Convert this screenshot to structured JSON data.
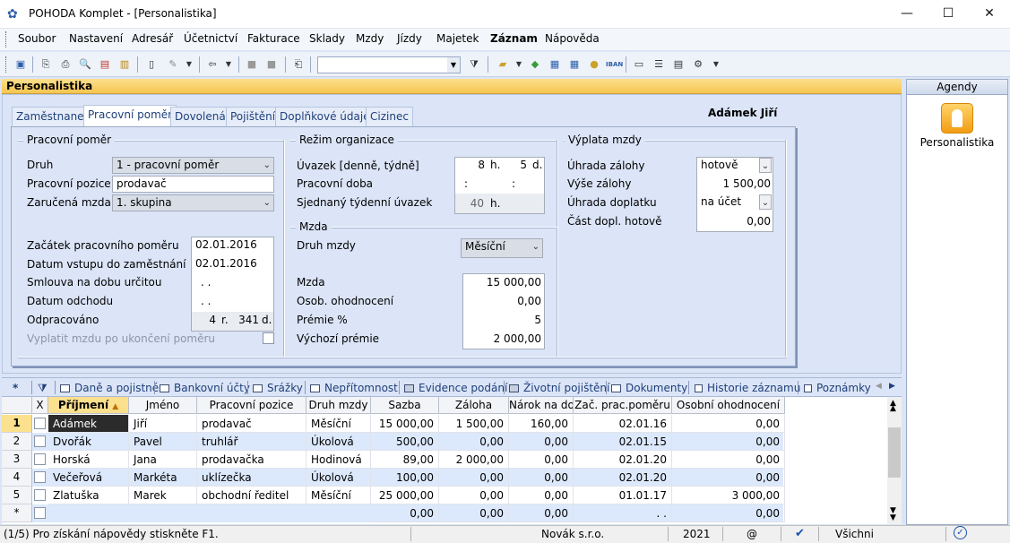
{
  "window": {
    "title": "POHODA Komplet - [Personalistika]",
    "minimize": "—",
    "maximize": "☐",
    "close": "✕"
  },
  "menu": [
    "Soubor",
    "Nastavení",
    "Adresář",
    "Účetnictví",
    "Fakturace",
    "Sklady",
    "Mzdy",
    "Jízdy",
    "Majetek",
    "Záznam",
    "Nápověda"
  ],
  "agenda": {
    "title": "Personalistika"
  },
  "agendy_panel": {
    "header": "Agendy",
    "item": "Personalistika"
  },
  "tabs": [
    "Zaměstnanec",
    "Pracovní poměr",
    "Dovolená",
    "Pojištění",
    "Doplňkové údaje",
    "Cizinec"
  ],
  "active_tab": "Pracovní poměr",
  "employee_name": "Adámek Jiří",
  "pracovni_pomer": {
    "title": "Pracovní poměr",
    "druh_label": "Druh",
    "druh_value": "1 - pracovní poměr",
    "pozice_label": "Pracovní pozice",
    "pozice_value": "prodavač",
    "mzda_label": "Zaručená mzda",
    "mzda_value": "1. skupina",
    "zacatek_label": "Začátek pracovního poměru",
    "zacatek_value": "02.01.2016",
    "vstup_label": "Datum vstupu do zaměstnání",
    "vstup_value": "02.01.2016",
    "urcita_label": "Smlouva na dobu určitou",
    "urcita_value": ". .",
    "odchod_label": "Datum odchodu",
    "odchod_value": ". .",
    "odpracovano_label": "Odpracováno",
    "odpracovano_r": "4",
    "odpracovano_r_unit": "r.",
    "odpracovano_d": "341",
    "odpracovano_d_unit": "d.",
    "vyplatit_label": "Vyplatit mzdu po ukončení poměru"
  },
  "rezim": {
    "title": "Režim organizace",
    "uvazek_label": "Úvazek  [denně, týdně]",
    "uvazek_h": "8",
    "uvazek_h_unit": "h.",
    "uvazek_d": "5",
    "uvazek_d_unit": "d.",
    "doba_label": "Pracovní doba",
    "doba_1": ":",
    "doba_2": ":",
    "sjednany_label": "Sjednaný týdenní úvazek",
    "sjednany_value": "40",
    "sjednany_unit": "h."
  },
  "mzda": {
    "title": "Mzda",
    "druh_label": "Druh mzdy",
    "druh_value": "Měsíční",
    "mzda_label": "Mzda",
    "mzda_value": "15 000,00",
    "osob_label": "Osob. ohodnocení",
    "osob_value": "0,00",
    "premie_label": "Prémie %",
    "premie_value": "5",
    "vychozi_label": "Výchozí prémie",
    "vychozi_value": "2 000,00"
  },
  "vyplata": {
    "title": "Výplata mzdy",
    "uhrada_zal_label": "Úhrada zálohy",
    "uhrada_zal_value": "hotově",
    "vyse_label": "Výše zálohy",
    "vyse_value": "1 500,00",
    "uhrada_dopl_label": "Úhrada doplatku",
    "uhrada_dopl_value": "na účet",
    "cast_label": "Část dopl. hotově",
    "cast_value": "0,00"
  },
  "bottom_tabs": {
    "star": "*",
    "items": [
      "Daně a pojistné",
      "Bankovní účty",
      "Srážky",
      "Nepřítomnost",
      "Evidence podání",
      "Životní pojištění",
      "Dokumenty",
      "Historie záznamu",
      "Poznámky"
    ]
  },
  "grid": {
    "columns": [
      "X",
      "Příjmení",
      "Jméno",
      "Pracovní pozice",
      "Druh mzdy",
      "Sazba",
      "Záloha",
      "Nárok na dov",
      "Zač. prac.poměru",
      "Osobní ohodnocení"
    ],
    "rows": [
      {
        "n": "1",
        "prijmeni": "Adámek",
        "jmeno": "Jiří",
        "pozice": "prodavač",
        "druh": "Měsíční",
        "sazba": "15 000,00",
        "zaloha": "1 500,00",
        "narok": "160,00",
        "zac": "02.01.16",
        "osob": "0,00"
      },
      {
        "n": "2",
        "prijmeni": "Dvořák",
        "jmeno": "Pavel",
        "pozice": "truhlář",
        "druh": "Úkolová",
        "sazba": "500,00",
        "zaloha": "0,00",
        "narok": "0,00",
        "zac": "02.01.15",
        "osob": "0,00"
      },
      {
        "n": "3",
        "prijmeni": "Horská",
        "jmeno": "Jana",
        "pozice": "prodavačka",
        "druh": "Hodinová",
        "sazba": "89,00",
        "zaloha": "2 000,00",
        "narok": "0,00",
        "zac": "02.01.20",
        "osob": "0,00"
      },
      {
        "n": "4",
        "prijmeni": "Večeřová",
        "jmeno": "Markéta",
        "pozice": "uklízečka",
        "druh": "Úkolová",
        "sazba": "100,00",
        "zaloha": "0,00",
        "narok": "0,00",
        "zac": "02.01.20",
        "osob": "0,00"
      },
      {
        "n": "5",
        "prijmeni": "Zlatuška",
        "jmeno": "Marek",
        "pozice": "obchodní ředitel",
        "druh": "Měsíční",
        "sazba": "25 000,00",
        "zaloha": "0,00",
        "narok": "0,00",
        "zac": "01.01.17",
        "osob": "3 000,00"
      }
    ],
    "new_row": {
      "n": "*",
      "sazba": "0,00",
      "zaloha": "0,00",
      "narok": "0,00",
      "zac": ". .",
      "osob": "0,00"
    }
  },
  "status": {
    "help": "(1/5) Pro získání nápovědy stiskněte F1.",
    "company": "Novák s.r.o.",
    "year": "2021",
    "at": "@",
    "filter": "Všichni"
  }
}
